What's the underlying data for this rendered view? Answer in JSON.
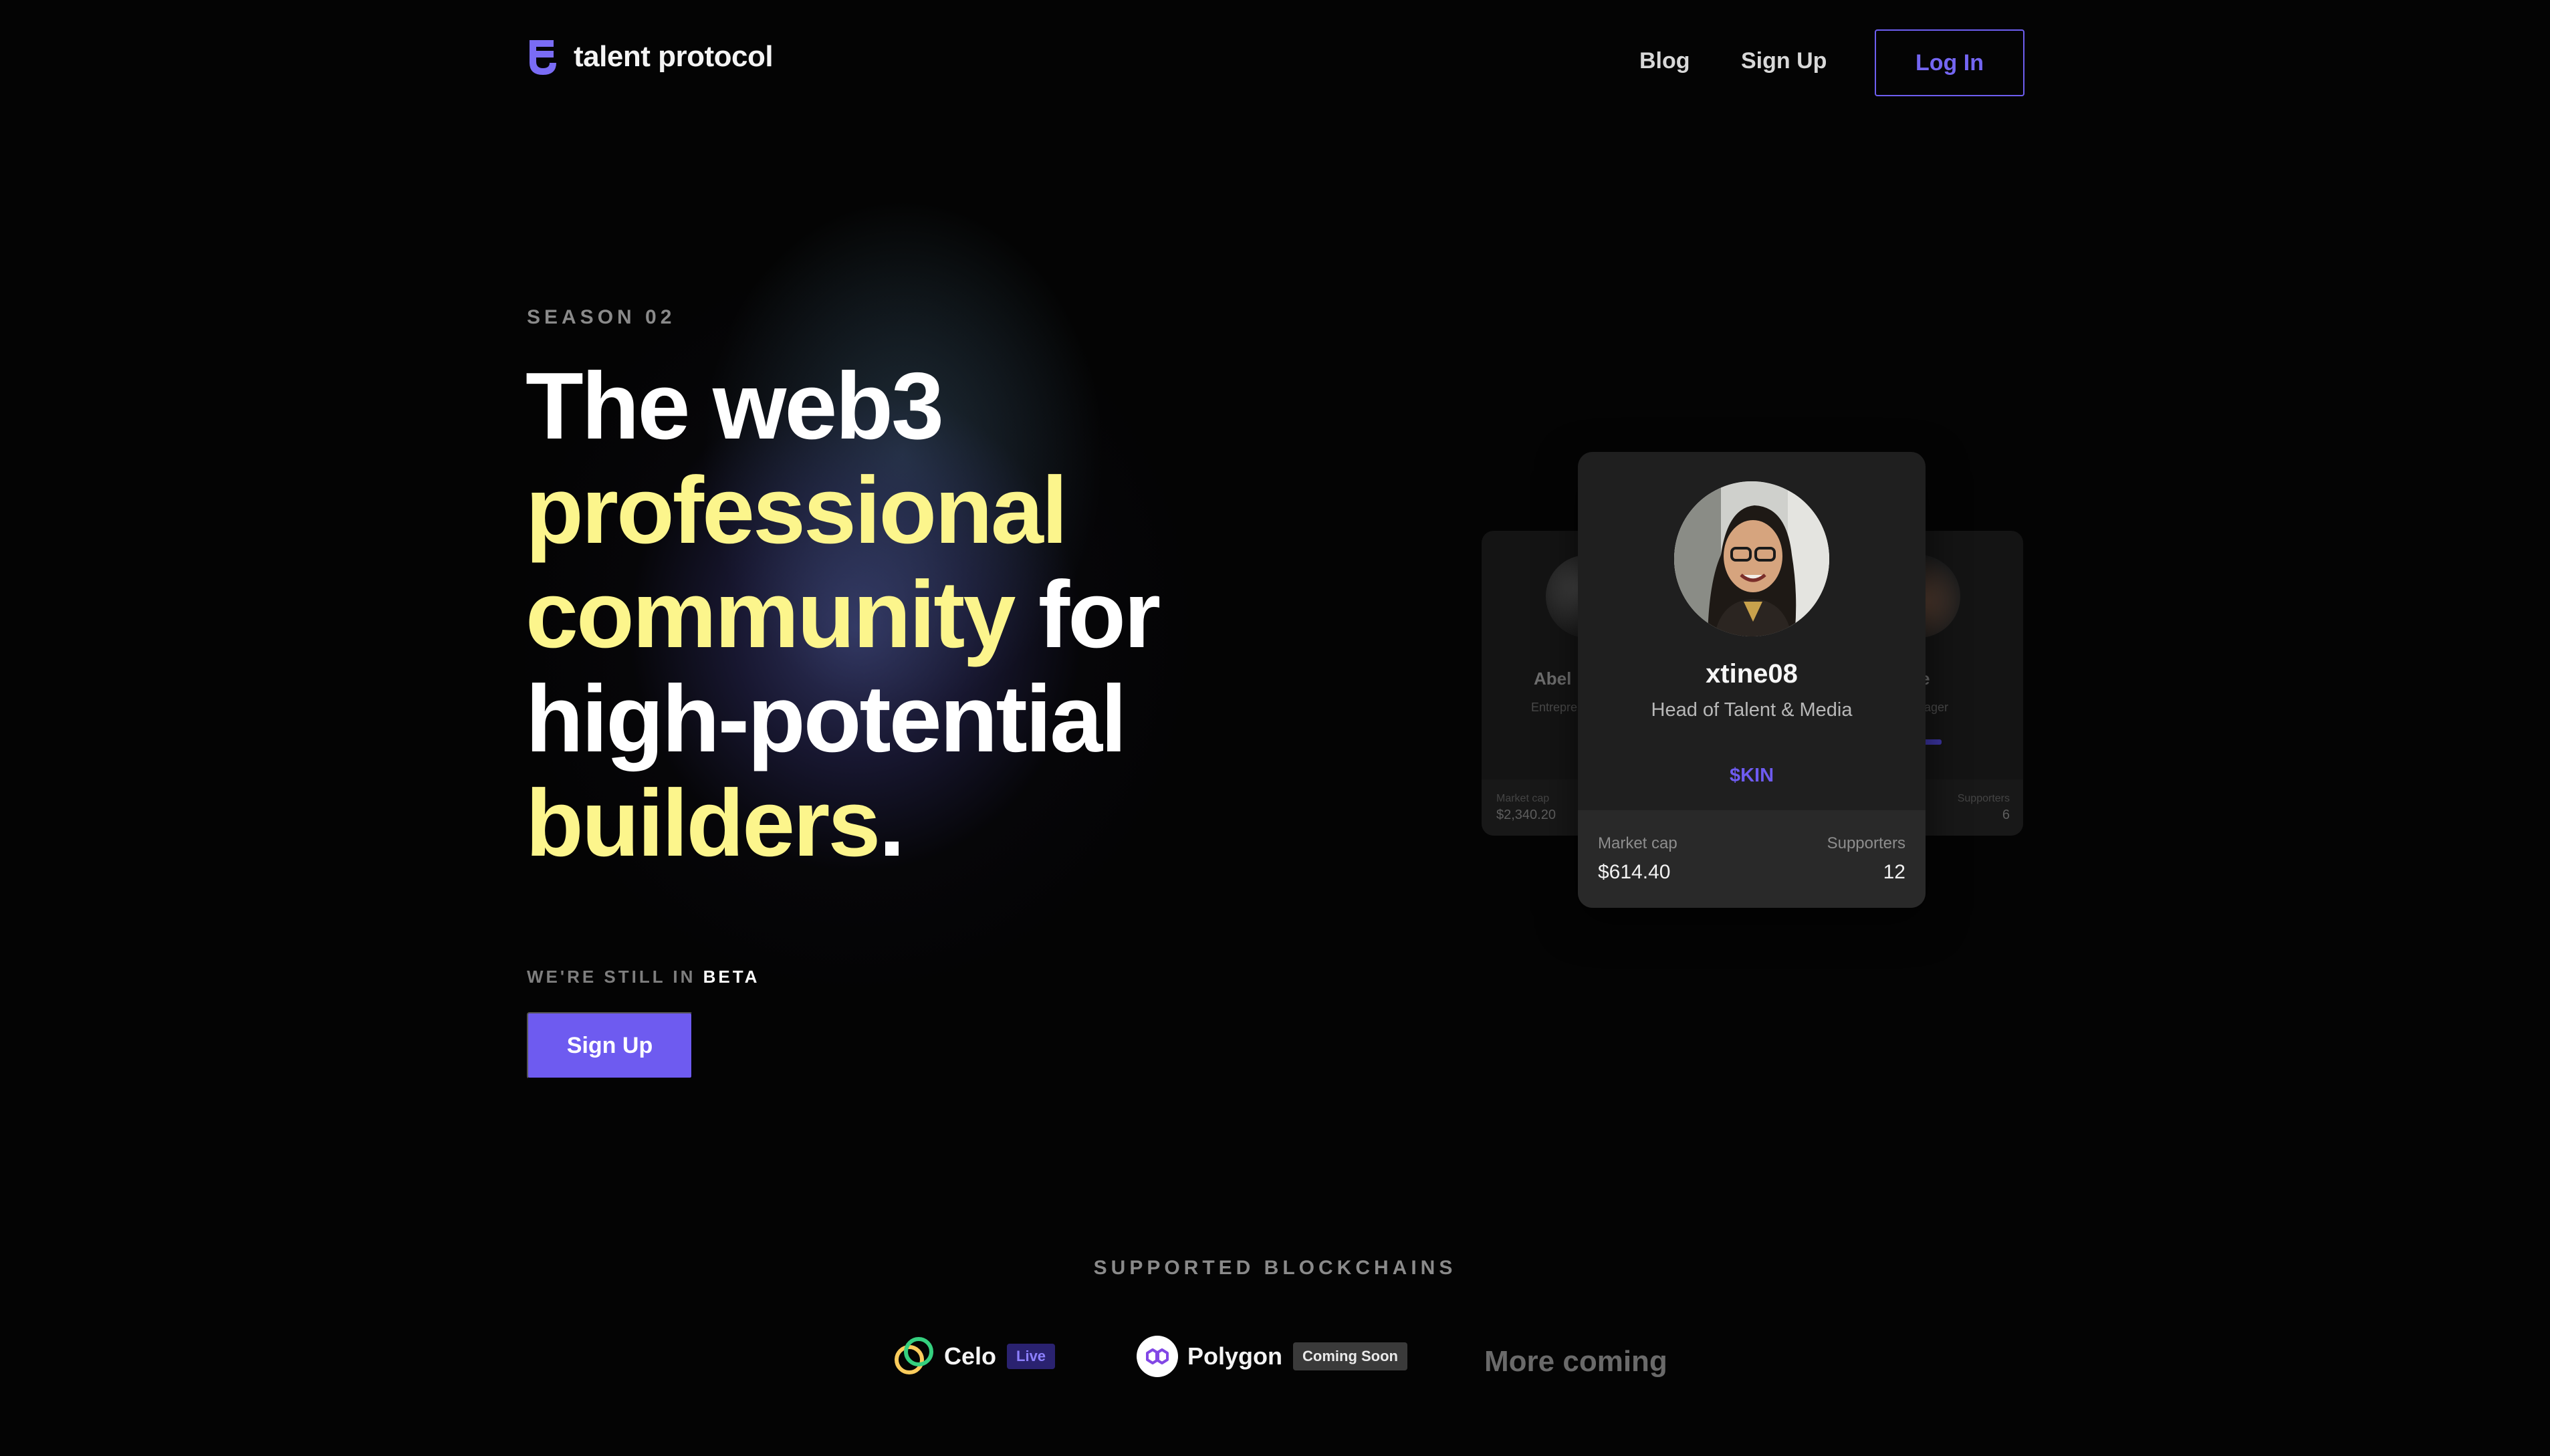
{
  "nav": {
    "logo_text": "talent protocol",
    "links": [
      "Blog",
      "Sign Up"
    ],
    "login_label": "Log In"
  },
  "hero": {
    "eyebrow": "SEASON 02",
    "headline": {
      "w1": "The web3",
      "w2": "professional",
      "w3": "community",
      "w4": "for",
      "w5": "high-potential",
      "w6": "builders",
      "w7": "."
    },
    "beta_prefix": "WE'RE STILL IN",
    "beta_word": "BETA",
    "cta_label": "Sign Up"
  },
  "cards": {
    "left": {
      "name": "Abel",
      "role": "Entrepre",
      "market_cap_label": "Market cap",
      "market_cap": "$2,340.20"
    },
    "right": {
      "name": "e",
      "role": "nager",
      "supporters_label": "Supporters",
      "supporters": "6"
    },
    "main": {
      "name": "xtine08",
      "role": "Head of Talent & Media",
      "token": "$KIN",
      "market_cap_label": "Market cap",
      "market_cap": "$614.40",
      "supporters_label": "Supporters",
      "supporters": "12"
    }
  },
  "blockchains": {
    "title": "SUPPORTED BLOCKCHAINS",
    "items": [
      {
        "name": "Celo",
        "badge": "Live"
      },
      {
        "name": "Polygon",
        "badge": "Coming Soon"
      }
    ],
    "more": "More coming"
  },
  "colors": {
    "accent": "#6e5bf0",
    "highlight": "#fcf58c",
    "background": "#040404"
  }
}
